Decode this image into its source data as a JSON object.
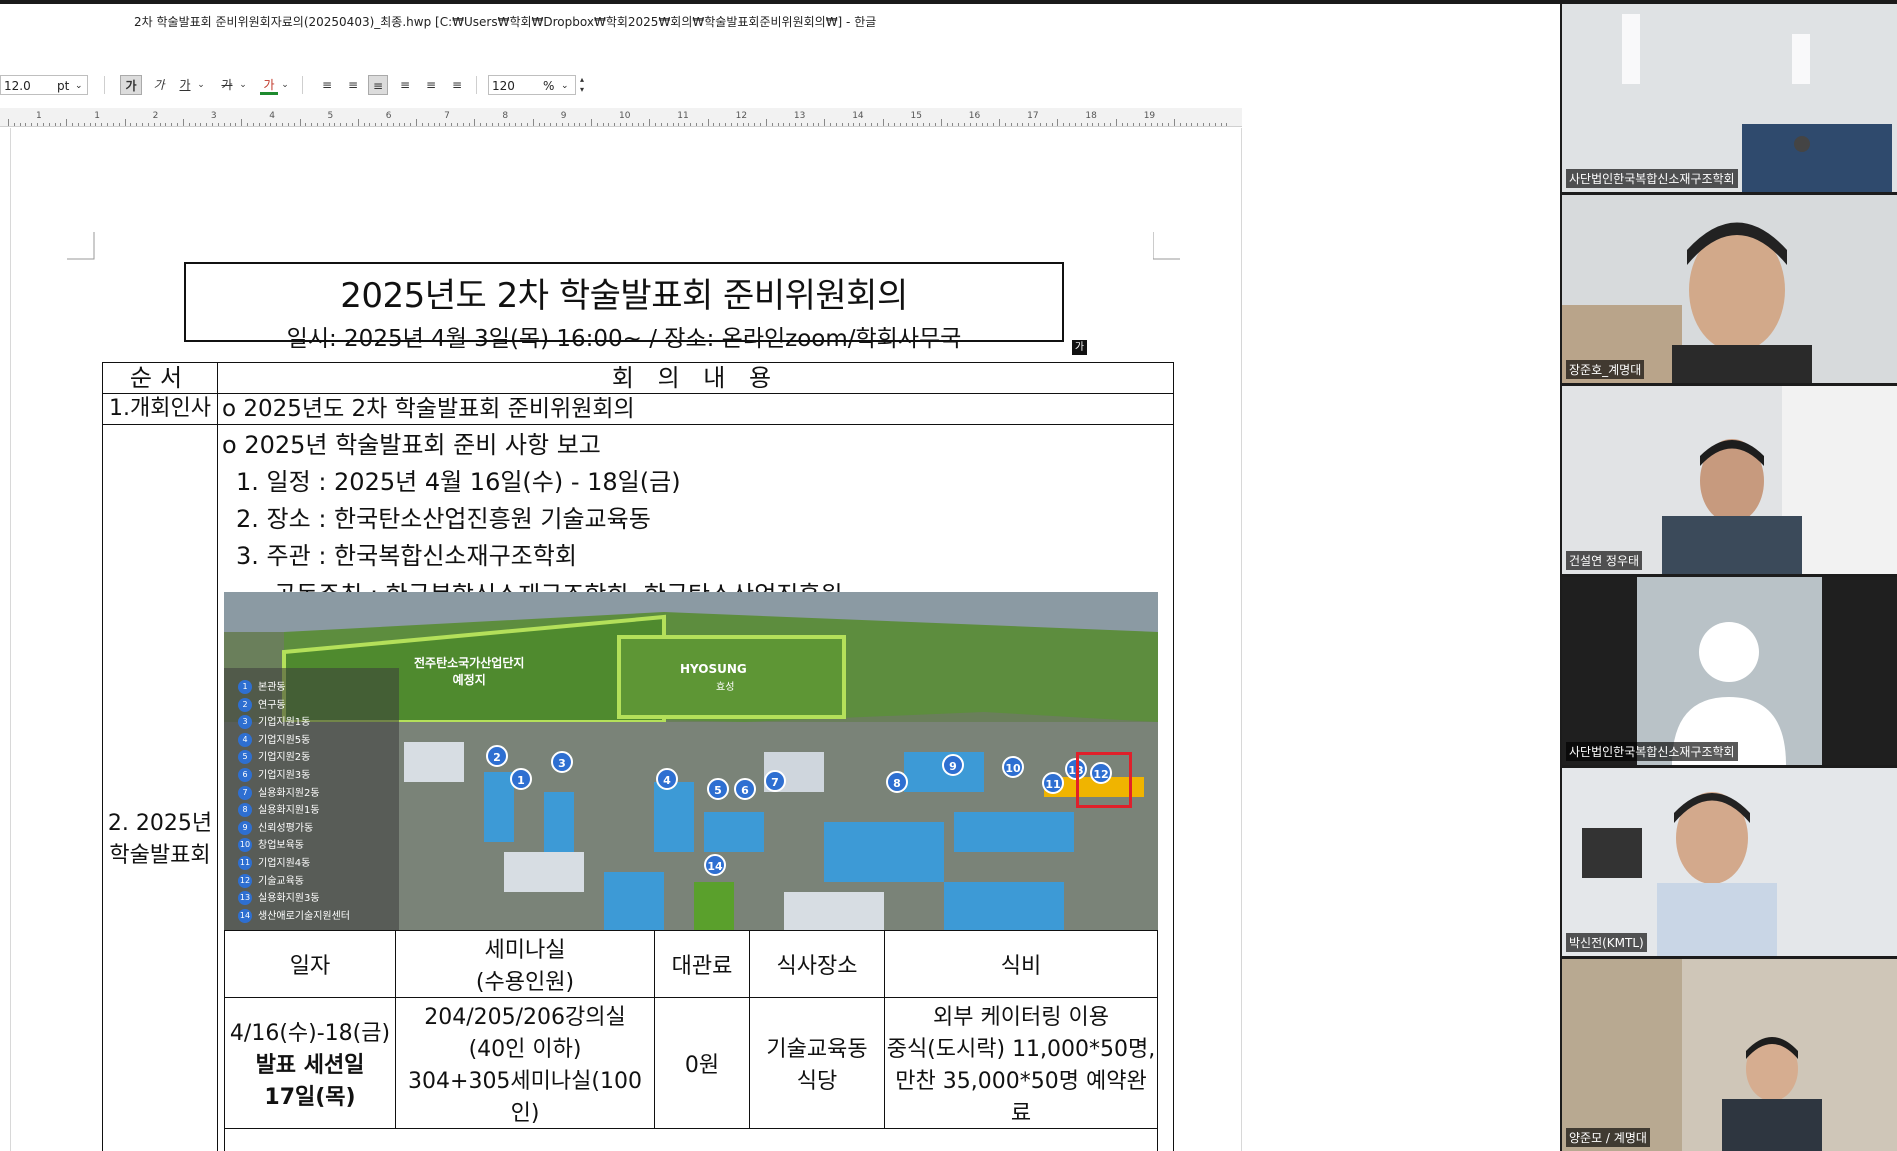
{
  "window": {
    "title": "2차 학술발표회 준비위원회자료의(20250403)_최종.hwp [C:₩Users₩학회₩Dropbox₩학회2025₩회의₩학술발표회준비위원회의₩] - 한글"
  },
  "toolbar": {
    "font_size": "12.0",
    "font_unit": "pt",
    "bold": "가",
    "italic": "가",
    "underline": "가",
    "strike": "가",
    "color": "가",
    "zoom": "120",
    "zoom_unit": "%"
  },
  "ruler": {
    "labels": [
      "1",
      "1",
      "2",
      "3",
      "4",
      "5",
      "6",
      "7",
      "8",
      "9",
      "10",
      "11",
      "12",
      "13",
      "14",
      "15",
      "16",
      "17",
      "18",
      "19"
    ]
  },
  "doc": {
    "title": "2025년도 2차 학술발표회 준비위원회의",
    "subtitle": "일시: 2025년 4월 3일(목) 16:00~ / 장소: 온라인zoom/학회사무국",
    "badge": "가",
    "table_header": {
      "col1": "순서",
      "col2": "회 의 내 용"
    },
    "row1": {
      "label": "1.개회인사",
      "content": "o 2025년도 2차 학술발표회 준비위원회의"
    },
    "row2": {
      "label_line1": "2. 2025년",
      "label_line2": "학술발표회",
      "lines": [
        "o 2025년 학술발표회 준비 사항 보고",
        "1. 일정 : 2025년 4월 16일(수) - 18일(금)",
        "2. 장소 : 한국탄소산업진흥원 기술교육동",
        "3. 주관 : 한국복합신소재구조학회",
        "공동주최 : 한국복합신소재구조학회, 한국탄소산업진흥원"
      ]
    },
    "map": {
      "region_label_line1": "전주탄소국가산업단지",
      "region_label_line2": "예정지",
      "brand": "HYOSUNG",
      "brand_kr": "효성",
      "legend": [
        {
          "n": "1",
          "name": "본관동"
        },
        {
          "n": "2",
          "name": "연구동"
        },
        {
          "n": "3",
          "name": "기업지원1동"
        },
        {
          "n": "4",
          "name": "기업지원5동"
        },
        {
          "n": "5",
          "name": "기업지원2동"
        },
        {
          "n": "6",
          "name": "기업지원3동"
        },
        {
          "n": "7",
          "name": "실용화지원2동"
        },
        {
          "n": "8",
          "name": "실용화지원1동"
        },
        {
          "n": "9",
          "name": "신뢰성평가동"
        },
        {
          "n": "10",
          "name": "창업보육동"
        },
        {
          "n": "11",
          "name": "기업지원4동"
        },
        {
          "n": "12",
          "name": "기술교육동"
        },
        {
          "n": "13",
          "name": "실용화지원3동"
        },
        {
          "n": "14",
          "name": "생산애로기술지원센터"
        }
      ]
    },
    "subtable": {
      "headers": [
        "일자",
        "세미나실",
        "(수용인원)",
        "대관료",
        "식사장소",
        "식비"
      ],
      "row": {
        "date_line1": "4/16(수)-18(금)",
        "date_line2": "발표 세션일",
        "date_line3": "17일(목)",
        "room_line1": "204/205/206강의실",
        "room_line2": "(40인 이하)",
        "room_line3": "304+305세미나실(100인)",
        "fee": "0원",
        "meal_line1": "기술교육동",
        "meal_line2": "식당",
        "cost_line1": "외부 케이터링 이용",
        "cost_line2": "중식(도시락) 11,000*50명,",
        "cost_line3": "만찬 35,000*50명 예약완료"
      }
    }
  },
  "participants": [
    {
      "name": "사단법인한국복합신소재구조학회"
    },
    {
      "name": "장준호_계명대"
    },
    {
      "name": "건설연 정우태"
    },
    {
      "name": "사단법인한국복합신소재구조학회"
    },
    {
      "name": "박신전(KMTL)"
    },
    {
      "name": "양준모 / 계명대"
    }
  ]
}
